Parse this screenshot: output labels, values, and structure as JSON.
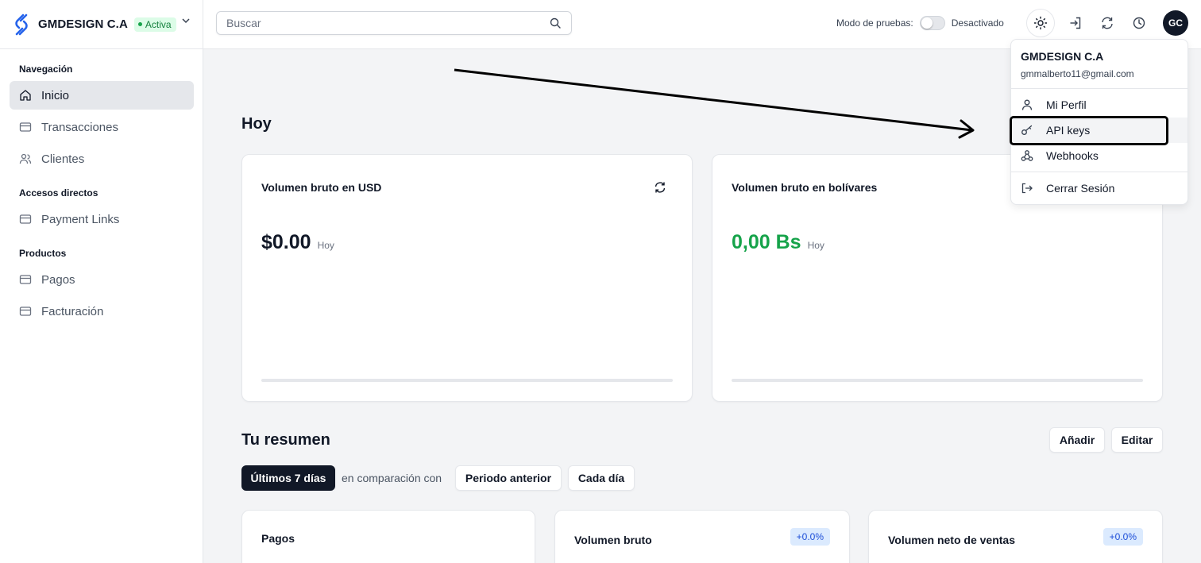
{
  "brand": {
    "name": "GMDESIGN C.A",
    "status": "Activa"
  },
  "sidebar": {
    "sections": [
      {
        "title": "Navegación",
        "items": [
          {
            "label": "Inicio",
            "icon": "home-icon"
          },
          {
            "label": "Transacciones",
            "icon": "card-icon"
          },
          {
            "label": "Clientes",
            "icon": "users-icon"
          }
        ]
      },
      {
        "title": "Accesos directos",
        "items": [
          {
            "label": "Payment Links",
            "icon": "card-icon"
          }
        ]
      },
      {
        "title": "Productos",
        "items": [
          {
            "label": "Pagos",
            "icon": "card-icon"
          },
          {
            "label": "Facturación",
            "icon": "card-icon"
          }
        ]
      }
    ]
  },
  "topbar": {
    "search_placeholder": "Buscar",
    "test_mode_label": "Modo de pruebas:",
    "test_mode_state": "Desactivado",
    "avatar_initials": "GC"
  },
  "main": {
    "today_title": "Hoy",
    "card_usd": {
      "title": "Volumen bruto en USD",
      "value": "$0.00",
      "label": "Hoy",
      "progress": 0
    },
    "card_bs": {
      "title": "Volumen bruto en bolívares",
      "value": "0,00 Bs",
      "label": "Hoy",
      "progress": 0
    },
    "summary_title": "Tu resumen",
    "add_button": "Añadir",
    "edit_button": "Editar",
    "period_button": "Últimos 7 días",
    "compare_text": "en comparación con",
    "previous_button": "Periodo anterior",
    "granularity_button": "Cada día",
    "summary_cards": [
      {
        "title": "Pagos",
        "delta": ""
      },
      {
        "title": "Volumen bruto",
        "delta": "+0.0%"
      },
      {
        "title": "Volumen neto de ventas",
        "delta": "+0.0%"
      }
    ]
  },
  "dropdown": {
    "name": "GMDESIGN C.A",
    "email": "gmmalberto11@gmail.com",
    "items": [
      {
        "label": "Mi Perfil",
        "icon": "user-icon"
      },
      {
        "label": "API keys",
        "icon": "key-icon"
      },
      {
        "label": "Webhooks",
        "icon": "webhook-icon"
      },
      {
        "label": "Cerrar Sesión",
        "icon": "logout-icon"
      }
    ]
  },
  "colors": {
    "accent_dark": "#111827",
    "bs_green": "#16a34a",
    "badge_green_bg": "#dcfce7",
    "delta_blue": "#1d4ed8"
  }
}
